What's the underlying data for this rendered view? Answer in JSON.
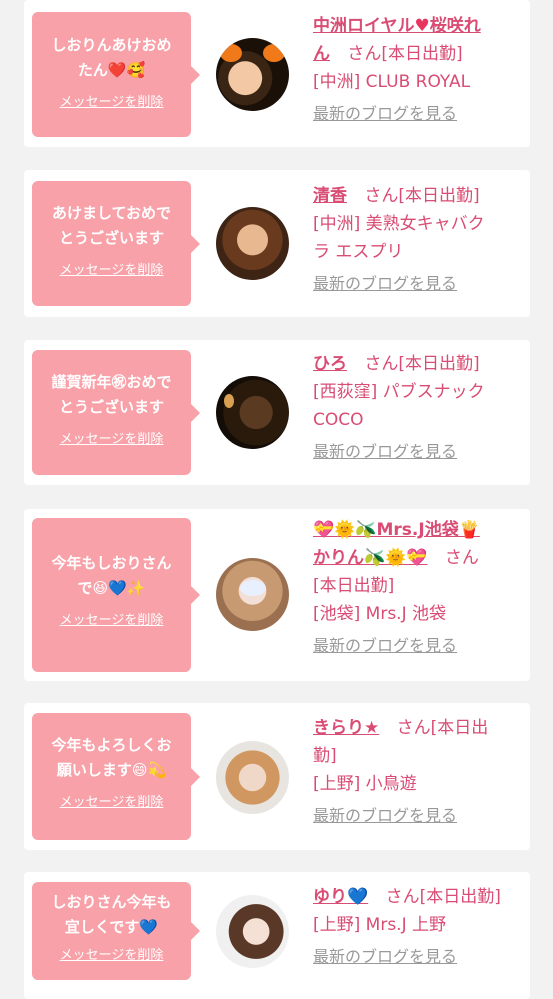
{
  "common": {
    "delete_label": "メッセージを削除",
    "blog_label": "最新のブログを見る",
    "san": "さん"
  },
  "colors": {
    "bubble": "#f8a1a9",
    "name": "#d94c73",
    "blog_link": "#999999",
    "background": "#f2f2f2"
  },
  "messages": [
    {
      "text_line1": "しおりんあけおめ",
      "text_line2": "たん❤️🥰",
      "name_a": "中洲ロイヤル",
      "name_heart": "♥",
      "name_b": "桜咲れ",
      "name_c": "ん",
      "status": "[本日出勤]",
      "shop": "[中洲] CLUB ROYAL"
    },
    {
      "text_line1": "あけましておめで",
      "text_line2": "とうございます",
      "name": "清香",
      "status": "[本日出勤]",
      "shop_line1": "[中洲] 美熟女キャバク",
      "shop_line2": "ラ エスプリ"
    },
    {
      "text_line1": "謹賀新年㊗おめで",
      "text_line2": "とうございます",
      "name": "ひろ",
      "status": "[本日出勤]",
      "shop_line1": "[西荻窪] パブスナック",
      "shop_line2": "COCO"
    },
    {
      "text_line1": "今年もしおりさん",
      "text_line2": "で😆💙✨",
      "name_line1": "💝🌞🫒Mrs.J池袋🍟",
      "name_line2": "かりん🫒🌞💝",
      "status": "本日出勤",
      "shop": "[池袋] Mrs.J 池袋"
    },
    {
      "text_line1": "今年もよろしくお",
      "text_line2": "願いします😄💫",
      "name": "きらり★",
      "status_line1": "[本日出",
      "status_line2": "勤]",
      "shop": "[上野] 小鳥遊"
    },
    {
      "text_line1": "しおりさん今年も",
      "text_line2": "宜しくです💙",
      "name": "ゆり💙",
      "status": "[本日出勤]",
      "shop": "[上野] Mrs.J 上野"
    }
  ]
}
